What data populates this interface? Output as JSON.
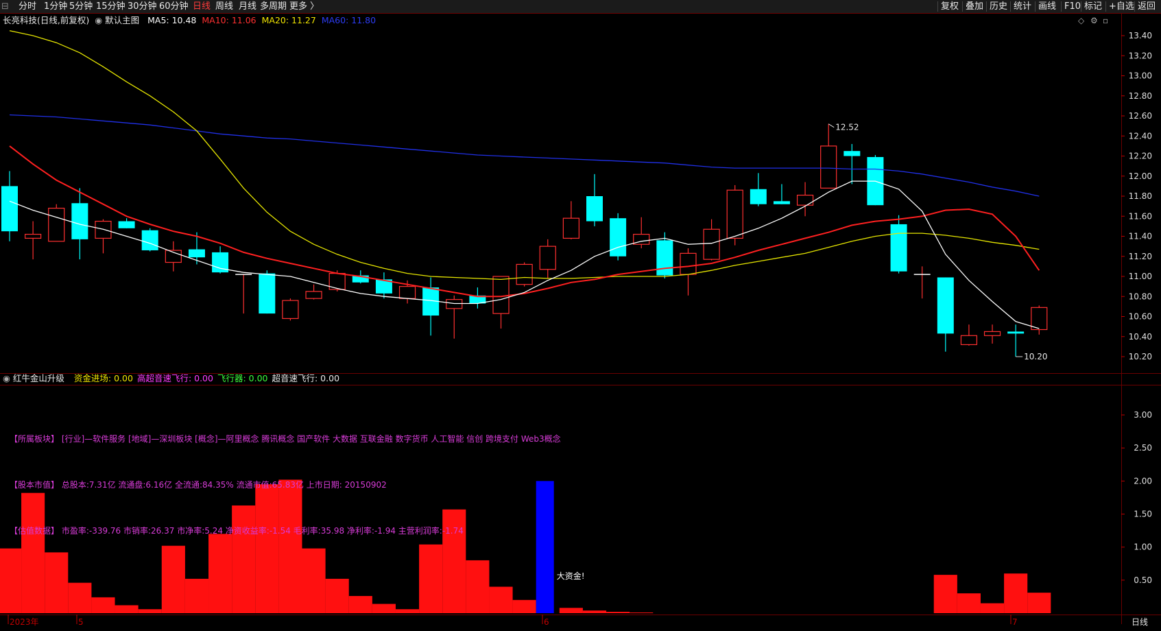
{
  "toolbar": {
    "period_tabs": [
      "分时",
      "1分钟",
      "5分钟",
      "15分钟",
      "30分钟",
      "60分钟",
      "日线",
      "周线",
      "月线",
      "多周期",
      "更多 〉"
    ],
    "active_tab": "日线",
    "right_buttons": [
      "复权",
      "叠加",
      "历史",
      "统计",
      "画线",
      "F10",
      "标记",
      "+自选",
      "返回"
    ]
  },
  "main_chart": {
    "title": "长亮科技(日线,前复权)",
    "template": "默认主图",
    "ma": [
      {
        "label": "MA5: 10.48",
        "color": "#ffffff"
      },
      {
        "label": "MA10: 11.06",
        "color": "#ff3030"
      },
      {
        "label": "MA20: 11.27",
        "color": "#f2e600"
      },
      {
        "label": "MA60: 11.80",
        "color": "#2c3cf5"
      }
    ],
    "y_axis_ticks": [
      "13.40",
      "13.20",
      "13.00",
      "12.80",
      "12.60",
      "12.40",
      "12.20",
      "12.00",
      "11.80",
      "11.60",
      "11.40",
      "11.20",
      "11.00",
      "10.80",
      "10.60",
      "10.40",
      "10.20"
    ],
    "high_marker": "12.52",
    "low_marker": "10.20",
    "candles": [
      [
        11.9,
        11.45,
        12.05,
        11.35
      ],
      [
        11.38,
        11.42,
        11.55,
        11.17
      ],
      [
        11.35,
        11.68,
        11.72,
        11.35
      ],
      [
        11.73,
        11.37,
        11.88,
        11.17
      ],
      [
        11.38,
        11.55,
        11.57,
        11.23
      ],
      [
        11.55,
        11.48,
        11.58,
        11.48
      ],
      [
        11.46,
        11.26,
        11.48,
        11.25
      ],
      [
        11.14,
        11.26,
        11.35,
        11.05
      ],
      [
        11.27,
        11.19,
        11.44,
        11.12
      ],
      [
        11.24,
        11.04,
        11.3,
        11.03
      ],
      [
        11.02,
        11.02,
        11.02,
        10.63
      ],
      [
        11.03,
        10.63,
        11.06,
        10.63
      ],
      [
        10.58,
        10.76,
        10.78,
        10.56
      ],
      [
        10.78,
        10.85,
        10.92,
        10.77
      ],
      [
        10.87,
        11.03,
        11.06,
        10.85
      ],
      [
        11.01,
        10.94,
        11.06,
        10.93
      ],
      [
        10.97,
        10.83,
        11.04,
        10.78
      ],
      [
        10.78,
        10.9,
        10.96,
        10.73
      ],
      [
        10.89,
        10.61,
        10.99,
        10.41
      ],
      [
        10.68,
        10.77,
        10.81,
        10.38
      ],
      [
        10.81,
        10.73,
        10.89,
        10.68
      ],
      [
        10.63,
        11.0,
        11.0,
        10.48
      ],
      [
        10.92,
        11.12,
        11.14,
        10.9
      ],
      [
        11.07,
        11.3,
        11.37,
        10.98
      ],
      [
        11.38,
        11.58,
        11.75,
        11.37
      ],
      [
        11.8,
        11.55,
        12.02,
        11.5
      ],
      [
        11.58,
        11.2,
        11.63,
        11.16
      ],
      [
        11.32,
        11.42,
        11.59,
        11.28
      ],
      [
        11.36,
        11.01,
        11.44,
        10.98
      ],
      [
        11.02,
        11.23,
        11.28,
        10.81
      ],
      [
        11.17,
        11.47,
        11.57,
        11.16
      ],
      [
        11.38,
        11.86,
        11.91,
        11.31
      ],
      [
        11.87,
        11.72,
        12.03,
        11.7
      ],
      [
        11.75,
        11.72,
        11.92,
        11.72
      ],
      [
        11.71,
        11.81,
        11.94,
        11.6
      ],
      [
        11.88,
        12.3,
        12.52,
        11.88
      ],
      [
        12.25,
        12.2,
        12.32,
        11.92
      ],
      [
        12.19,
        11.71,
        12.21,
        11.71
      ],
      [
        11.52,
        11.05,
        11.61,
        11.03
      ],
      [
        11.02,
        11.02,
        11.1,
        10.78
      ],
      [
        10.99,
        10.43,
        10.99,
        10.25
      ],
      [
        10.32,
        10.41,
        10.52,
        10.31
      ],
      [
        10.41,
        10.45,
        10.52,
        10.33
      ],
      [
        10.45,
        10.43,
        10.52,
        10.2
      ],
      [
        10.47,
        10.69,
        10.71,
        10.42
      ]
    ],
    "ma5": [
      11.75,
      11.66,
      11.59,
      11.52,
      11.47,
      11.4,
      11.33,
      11.24,
      11.16,
      11.08,
      11.04,
      11.02,
      11.0,
      10.94,
      10.88,
      10.83,
      10.8,
      10.78,
      10.76,
      10.73,
      10.73,
      10.77,
      10.84,
      10.96,
      11.06,
      11.2,
      11.29,
      11.35,
      11.38,
      11.32,
      11.33,
      11.4,
      11.48,
      11.58,
      11.7,
      11.84,
      11.95,
      11.95,
      11.87,
      11.65,
      11.22,
      10.96,
      10.75,
      10.55,
      10.48
    ],
    "ma10": [
      12.3,
      12.12,
      11.96,
      11.84,
      11.72,
      11.6,
      11.52,
      11.45,
      11.4,
      11.33,
      11.24,
      11.18,
      11.13,
      11.08,
      11.03,
      11.0,
      10.96,
      10.92,
      10.88,
      10.84,
      10.8,
      10.8,
      10.83,
      10.88,
      10.94,
      10.97,
      11.02,
      11.05,
      11.08,
      11.1,
      11.13,
      11.19,
      11.26,
      11.32,
      11.38,
      11.44,
      11.51,
      11.55,
      11.57,
      11.6,
      11.66,
      11.67,
      11.62,
      11.4,
      11.06
    ],
    "ma20": [
      13.45,
      13.4,
      13.33,
      13.23,
      13.09,
      12.94,
      12.8,
      12.64,
      12.45,
      12.17,
      11.88,
      11.64,
      11.45,
      11.32,
      11.22,
      11.14,
      11.08,
      11.03,
      11.0,
      10.99,
      10.98,
      10.97,
      10.99,
      10.98,
      10.98,
      10.99,
      11.0,
      11.0,
      11.0,
      11.02,
      11.06,
      11.11,
      11.15,
      11.19,
      11.23,
      11.29,
      11.35,
      11.4,
      11.43,
      11.43,
      11.41,
      11.38,
      11.34,
      11.31,
      11.27
    ],
    "ma60": [
      12.61,
      12.6,
      12.59,
      12.57,
      12.55,
      12.53,
      12.51,
      12.48,
      12.45,
      12.42,
      12.4,
      12.38,
      12.37,
      12.35,
      12.33,
      12.31,
      12.29,
      12.27,
      12.25,
      12.23,
      12.21,
      12.2,
      12.19,
      12.18,
      12.17,
      12.16,
      12.15,
      12.14,
      12.13,
      12.11,
      12.09,
      12.08,
      12.08,
      12.08,
      12.08,
      12.08,
      12.07,
      12.07,
      12.05,
      12.02,
      11.98,
      11.94,
      11.89,
      11.85,
      11.8
    ]
  },
  "x_axis": {
    "labels": [
      "2023年",
      "5",
      "6",
      "7"
    ]
  },
  "indicator": {
    "name": "红牛金山升级",
    "fields": [
      {
        "label": "资金进场: 0.00",
        "color": "#f2e600"
      },
      {
        "label": "高超音速飞行: 0.00",
        "color": "#ff3cff"
      },
      {
        "label": "飞行器: 0.00",
        "color": "#3cff3c"
      },
      {
        "label": "超音速飞行: 0.00",
        "color": "#e8e8e8"
      }
    ],
    "y_axis_ticks": [
      "3.00",
      "2.50",
      "2.00",
      "1.50",
      "1.00",
      "0.50"
    ],
    "bars": [
      0.98,
      1.82,
      0.92,
      0.46,
      0.24,
      0.12,
      0.06,
      1.02,
      0.52,
      1.2,
      1.63,
      1.95,
      2.02,
      0.98,
      0.52,
      0.26,
      0.14,
      0.06,
      1.04,
      1.57,
      0.8,
      0.4,
      0.2,
      2.0,
      0.08,
      0.04,
      0.02,
      0.01,
      0,
      0,
      0,
      0,
      0,
      0,
      0,
      0,
      0,
      0,
      0,
      0,
      0.58,
      0.3,
      0.15,
      0.6,
      0.31
    ],
    "blue_bar_index": 23,
    "big_funds_label": "大资金!"
  },
  "info_lines": {
    "sectors": "【所属板块】 [行业]—软件服务 [地域]—深圳板块 [概念]—阿里概念 腾讯概念 国产软件 大数据 互联金融 数字货币 人工智能 信创 跨境支付 Web3概念",
    "market": "【股本市值】 总股本:7.31亿 流通盘:6.16亿 全流通:84.35% 流通市值:65.83亿 上市日期: 20150902",
    "valuation": "【估值数据】 市盈率:-339.76 市销率:26.37 市净率:5.24 净资收益率:-1.54 毛利率:35.98 净利率:-1.94 主营利润率:-1.74"
  },
  "bottom_right_label": "日线",
  "colors": {
    "up": "#ff3030",
    "down": "#00ffff",
    "grid": "#6b0000",
    "axis_text": "#e0e0e0",
    "ma5": "#ffffff",
    "ma10": "#ff2020",
    "ma20": "#e6e600",
    "ma60": "#2030e8",
    "indicator_bar": "#ff1010",
    "blue_bar": "#0000ff",
    "info_text": "#d83cd8"
  }
}
